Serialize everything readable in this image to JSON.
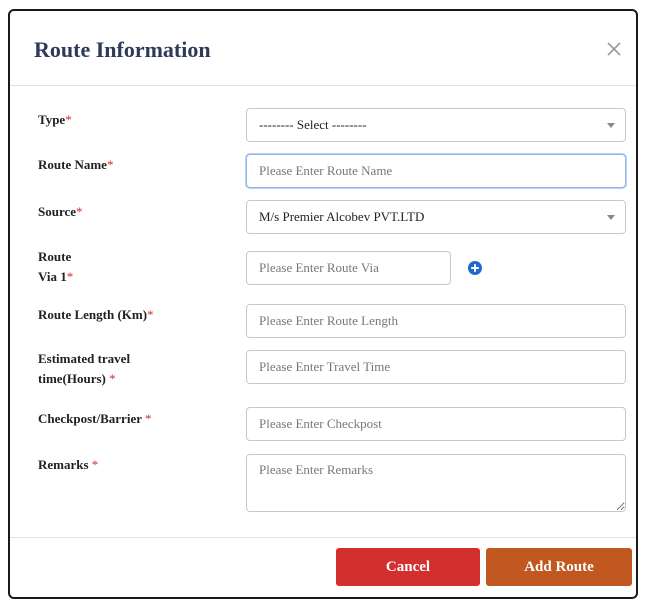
{
  "modal": {
    "title": "Route Information"
  },
  "form": {
    "type": {
      "label": "Type",
      "required_mark": "*",
      "selected": "-------- Select --------"
    },
    "route_name": {
      "label": "Route Name",
      "required_mark": "*",
      "placeholder": "Please Enter Route Name",
      "value": ""
    },
    "source": {
      "label": "Source",
      "required_mark": "*",
      "selected": "M/s Premier Alcobev PVT.LTD"
    },
    "route_via": {
      "label_line1": "Route",
      "label_line2": "Via 1",
      "required_mark": "*",
      "placeholder": "Please Enter Route Via",
      "value": ""
    },
    "route_length": {
      "label": "Route Length (Km)",
      "required_mark": "*",
      "placeholder": "Please Enter Route Length",
      "value": ""
    },
    "travel_time": {
      "label_line1": "Estimated travel",
      "label_line2": "time(Hours) ",
      "required_mark": "*",
      "placeholder": "Please Enter Travel Time",
      "value": ""
    },
    "checkpost": {
      "label": "Checkpost/Barrier ",
      "required_mark": "*",
      "placeholder": "Please Enter Checkpost",
      "value": ""
    },
    "remarks": {
      "label": "Remarks ",
      "required_mark": "*",
      "placeholder": "Please Enter Remarks",
      "value": ""
    }
  },
  "buttons": {
    "cancel_label": "Cancel",
    "add_label": "Add Route"
  },
  "icons": {
    "close": "close-icon",
    "add_via": "plus-circle-icon"
  },
  "colors": {
    "title": "#2e3a59",
    "required": "#d32f2f",
    "cancel": "#d32f2f",
    "add": "#c0581f",
    "add_via_icon": "#1e6ad2",
    "focus_border": "#8fb8e8"
  }
}
